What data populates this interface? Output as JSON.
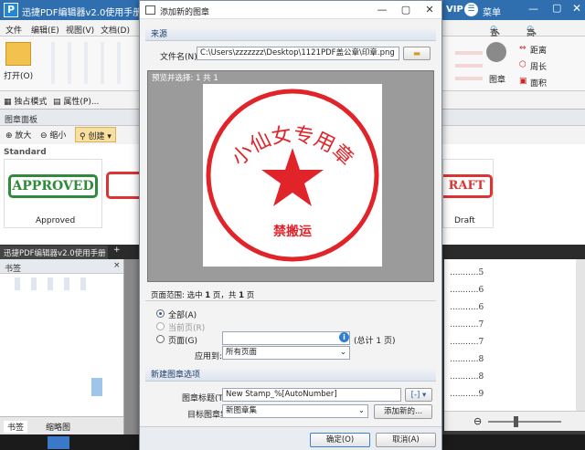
{
  "app": {
    "title": "迅捷PDF编辑器v2.0使用手册",
    "vip": "VIP",
    "menu_label": "菜单",
    "colors": {
      "titlebar": "#2f6fb0",
      "accent": "#1a5fb4",
      "stamp_red": "#e0242a"
    }
  },
  "menubar": [
    "文件",
    "编辑(E)",
    "视图(V)",
    "文档(D)"
  ],
  "ribbon": {
    "open_label": "打开(O)",
    "stamp_label": "图章",
    "find_label": "查找(F)",
    "advanced_find_label": "高级查找(S)",
    "distance_label": "距离",
    "perimeter_label": "周长",
    "area_label": "面积",
    "exclusive_mode": "独占模式",
    "properties": "属性(P)..."
  },
  "stamp_panel": {
    "title": "图章面板",
    "zoom_in": "放大",
    "zoom_out": "缩小",
    "create": "创建",
    "category": "Standard",
    "stamps": [
      {
        "label": "Approved",
        "text": "APPROVED"
      },
      {
        "label": "Draft",
        "text": "RAFT"
      }
    ]
  },
  "doc_tab": {
    "title": "迅捷PDF编辑器v2.0使用手册",
    "close": "×",
    "add": "+"
  },
  "bookmark_panel": {
    "title": "书签",
    "close": "×",
    "tabs": [
      "书签",
      "缩略图"
    ]
  },
  "toc_numbers": [
    "5",
    "6",
    "6",
    "7",
    "7",
    "8",
    "8",
    "9"
  ],
  "dialog": {
    "title": "添加新的图章",
    "source_group": "来源",
    "file_name_label": "文件名(N):",
    "file_path": "C:\\Users\\zzzzzzz\\Desktop\\1121PDF盖公章\\印章.png",
    "preview_label": "预览并选择: 1 共 1",
    "stamp_text_arc": "小仙女专用章",
    "stamp_text_bottom": "禁搬运",
    "page_range_prefix": "页面范围: 选中",
    "page_selected": "1",
    "page_range_mid": "页，共",
    "page_total": "1",
    "page_range_suffix": "页",
    "radio_all": "全部(A)",
    "radio_current": "当前页(R)",
    "radio_pages": "页面(G)",
    "total_note": "(总计 1 页)",
    "apply_to_label": "应用到:",
    "apply_to_value": "所有页面",
    "new_stamp_group": "新建图章选项",
    "stamp_title_label": "图章标题(T):",
    "stamp_title_value": "New Stamp_%[AutoNumber]",
    "target_collection_label": "目标图章集:",
    "target_collection_value": "新图章集",
    "add_new_button": "添加新的...",
    "ok_button": "确定(O)",
    "cancel_button": "取消(A)"
  }
}
